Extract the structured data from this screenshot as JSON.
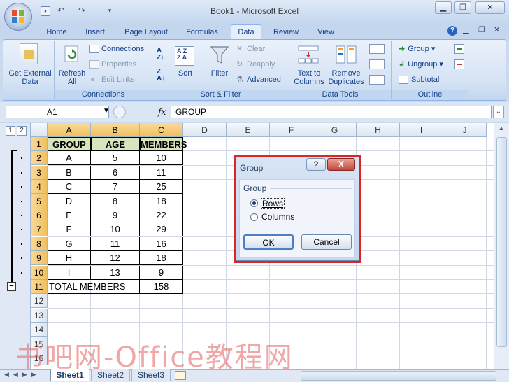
{
  "window": {
    "title": "Book1 - Microsoft Excel"
  },
  "tabs": [
    "Home",
    "Insert",
    "Page Layout",
    "Formulas",
    "Data",
    "Review",
    "View"
  ],
  "ribbon": {
    "get_external_data": "Get External Data",
    "refresh_all": "Refresh All",
    "connections": "Connections",
    "properties": "Properties",
    "edit_links": "Edit Links",
    "connections_group": "Connections",
    "sort_az": "A→Z",
    "sort_za": "Z→A",
    "sort": "Sort",
    "filter": "Filter",
    "clear": "Clear",
    "reapply": "Reapply",
    "advanced": "Advanced",
    "sort_filter_group": "Sort & Filter",
    "text_to_columns": "Text to Columns",
    "remove_duplicates": "Remove Duplicates",
    "data_tools_group": "Data Tools",
    "group": "Group",
    "ungroup": "Ungroup",
    "subtotal": "Subtotal",
    "outline_group": "Outline"
  },
  "formula_bar": {
    "name_box": "A1",
    "fx": "fx",
    "formula": "GROUP"
  },
  "outline_levels": [
    "1",
    "2"
  ],
  "columns": [
    "A",
    "B",
    "C",
    "D",
    "E",
    "F",
    "G",
    "H",
    "I",
    "J"
  ],
  "rows": [
    "1",
    "2",
    "3",
    "4",
    "5",
    "6",
    "7",
    "8",
    "9",
    "10",
    "11",
    "12",
    "13",
    "14",
    "15",
    "16"
  ],
  "table": {
    "headers": [
      "GROUP",
      "AGE",
      "MEMBERS"
    ],
    "data": [
      [
        "A",
        "5",
        "10"
      ],
      [
        "B",
        "6",
        "11"
      ],
      [
        "C",
        "7",
        "25"
      ],
      [
        "D",
        "8",
        "18"
      ],
      [
        "E",
        "9",
        "22"
      ],
      [
        "F",
        "10",
        "29"
      ],
      [
        "G",
        "11",
        "16"
      ],
      [
        "H",
        "12",
        "18"
      ],
      [
        "I",
        "13",
        "9"
      ]
    ],
    "total_label": "TOTAL MEMBERS",
    "total_value": "158"
  },
  "sheets": [
    "Sheet1",
    "Sheet2",
    "Sheet3"
  ],
  "dialog": {
    "title": "Group",
    "help": "?",
    "close": "X",
    "group_label": "Group",
    "rows": "Rows",
    "columns": "Columns",
    "selected": "Rows",
    "ok": "OK",
    "cancel": "Cancel"
  },
  "watermark": "书吧网-Office教程网",
  "colors": {
    "accent": "#15428b",
    "dialog_highlight": "#d9262b",
    "header_fill": "#d8e4bc"
  }
}
